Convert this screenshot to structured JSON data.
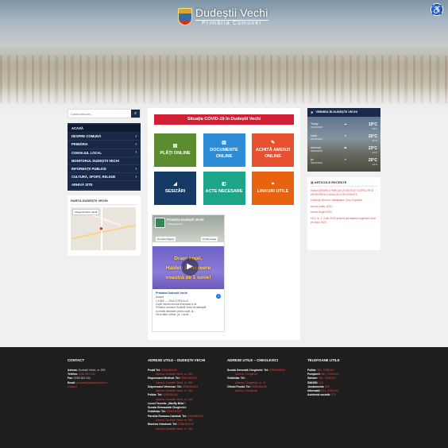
{
  "header": {
    "title": "Dudeștii Vechi",
    "subtitle": "Primăria Comunei"
  },
  "accessibility_icon": "accessibility-icon",
  "search": {
    "placeholder": "Caută articole..."
  },
  "menu": {
    "items": [
      {
        "label": "ACASĂ",
        "sub": false
      },
      {
        "label": "DESPRE COMUNĂ",
        "sub": true
      },
      {
        "label": "PRIMĂRIA",
        "sub": true
      },
      {
        "label": "CONSILIUL LOCAL",
        "sub": true
      },
      {
        "label": "MONITORUL DUDEȘTII VECHI",
        "sub": false
      },
      {
        "label": "INFORMAȚII PUBLICE",
        "sub": true
      },
      {
        "label": "CULTURĂ, SPORT, RELIGIE",
        "sub": true
      },
      {
        "label": "ARHIVĂ SITE",
        "sub": false
      }
    ]
  },
  "map_box": {
    "title": "HARTA DUDEȘTII VECHI",
    "button": "Afișează harta mărită"
  },
  "main": {
    "covid_banner": "Situația COVID-19 în Dudeștii Vechi",
    "tiles": [
      {
        "label1": "PLĂȚI ONLINE",
        "label2": "",
        "color": "#5b8d2f"
      },
      {
        "label1": "DOCUMENTE",
        "label2": "ONLINE",
        "color": "#2e8bd5"
      },
      {
        "label1": "ACHITĂ AMENZI",
        "label2": "ONLINE",
        "color": "#e8512f"
      },
      {
        "label1": "SESIZĂRI",
        "label2": "",
        "color": "#153a66"
      },
      {
        "label1": "ACTE NECESARE",
        "label2": "",
        "color": "#1da58a"
      },
      {
        "label1": "LINKURI UTILE",
        "label2": "",
        "color": "#e8620f"
      }
    ],
    "facebook": {
      "page_name": "Primăria Dudeștii Vechi",
      "likes": "2.002 aprecieri",
      "like_btn": "Îmi place Pagina",
      "send_btn": "Trimite mesaj",
      "poster_line1": "Dragi copii,",
      "poster_line2": "Haideți la recreere",
      "poster_line3": "voastră de 1 iunie!",
      "post_author": "Primăria Dudeștii Vechi",
      "post_time": "Aseară",
      "post_text1": "1 IUNIE — ZIUA COPILULUI",
      "post_text2": "Copiii merită cea mai frumoasă zi de",
      "post_text3": "Primăria comunei Dudeștii Vechi vă așteaptă",
      "post_text4": "cu multă distracție pentru copii, la...",
      "post_text5": "Vă invităm, mâine, joi, 1 iunie..."
    }
  },
  "weather": {
    "title": "VREMEA ÎN DUDEȘTII VECHI",
    "days": [
      {
        "day": "Today",
        "date": "01/06/2023",
        "temp": "19°C",
        "min": "10°C"
      },
      {
        "day": "marți",
        "date": "02/06/2023",
        "temp": "20°C",
        "min": "11°C"
      },
      {
        "day": "miercuri",
        "date": "03/06/2023",
        "temp": "23°C",
        "min": "13°C"
      },
      {
        "day": "joi",
        "date": "03/06/2023",
        "temp": "25°C",
        "min": "14°C"
      }
    ]
  },
  "articles": {
    "title": "ARTICOLE RECENTE",
    "items": [
      {
        "text": "INAUGURAREA PARCULUI DEDICAT COPIILOR ȘI INGRIJIREA CANALULUI DE IRIGAȚII",
        "date": ""
      },
      {
        "text": "Dudeștii Vechi în sărbătoare: Ziua Copilului",
        "date": ""
      },
      {
        "text": "Anunț public 2022",
        "date": ""
      },
      {
        "text": "Anunț Buget 2022",
        "date": ""
      },
      {
        "text": "HCL nr. 1, 3 din 2023 privind aprobarea bugetului local pe anul 2023",
        "date": ""
      }
    ]
  },
  "footer": {
    "contact": {
      "title": "CONTACT",
      "lines": [
        {
          "k": "Adresa:",
          "v": "Dudeștii Vechi, nr. 253"
        },
        {
          "k": "Telefon:",
          "v": "0256 384 104",
          "red": true
        },
        {
          "k": "Fax:",
          "v": "0256 384 104"
        },
        {
          "k": "Email:",
          "v": "primaria@dudestiivechi.ro",
          "red": true
        },
        {
          "k": "",
          "v": "Contact",
          "red": true
        }
      ]
    },
    "adrese_dv": {
      "title": "ADRESE UTILE – DUDEȘTII VECHI",
      "lines": [
        {
          "k": "Poștă Tel:",
          "v": "0256/384160"
        },
        {
          "k": "",
          "v": "Adresa: Dudeștii Vechi, nr. 253"
        },
        {
          "k": "Dispensarul Medical: Tel:",
          "v": "0256/384213"
        },
        {
          "k": "",
          "v": "Adresa: Dudeștii Vechi, nr. 253"
        },
        {
          "k": "Dispensarul Veterinar: Tel:",
          "v": "0256/384011"
        },
        {
          "k": "",
          "v": "Adresa: Dudeștii Vechi, nr. 253"
        },
        {
          "k": "Poliția: Tel:",
          "v": "0256/384111"
        },
        {
          "k": "",
          "v": "Adresa: Dudeștii Vechi, nr. 146"
        },
        {
          "k": "Liceul Teoretic „Bánffy Béla”:",
          "v": ""
        },
        {
          "k": "Școala Gimnazială Cheglevici:",
          "v": ""
        },
        {
          "k": "Grădinița: Tel:",
          "v": "0256/384027"
        },
        {
          "k": "Parohia Romano-Catolică: Tel:",
          "v": "0256/384124"
        },
        {
          "k": "",
          "v": "Adresa: Dudeștii Vechi, nr. 253"
        },
        {
          "k": "Biserica Ortodoxă: Tel:",
          "v": "0256/384040"
        },
        {
          "k": "",
          "v": "Adresa: Dudeștii Vechi, nr. 253"
        }
      ]
    },
    "adrese_ch": {
      "title": "ADRESE UTILE – CHEGLEVICI",
      "lines": [
        {
          "k": "Școala Generală Cheglevici: Tel:",
          "v": "0256/384094"
        },
        {
          "k": "",
          "v": "Adresa: Cheglevici"
        },
        {
          "k": "Grădinița: Tel:",
          "v": "–"
        },
        {
          "k": "",
          "v": "Adresa: Cheglevici, nr. 37"
        },
        {
          "k": "Oficiul Poștal: Tel:",
          "v": "0256/384030"
        },
        {
          "k": "",
          "v": "Adresa: Cheglevici"
        }
      ]
    },
    "telefoane": {
      "title": "TELEFOANE UTILE",
      "lines": [
        {
          "k": "Poliția:",
          "v": "981, 0256/112"
        },
        {
          "k": "Pompierii:",
          "v": "981, 0256/112"
        },
        {
          "k": "Salvare:",
          "v": "961, 0256/112"
        },
        {
          "k": "SMURD:",
          "v": "112"
        },
        {
          "k": "Jandarmeria:",
          "v": "956"
        },
        {
          "k": "Informații:",
          "v": "931, 0256/112"
        },
        {
          "k": "Asistență socială:",
          "v": "979"
        }
      ]
    }
  },
  "colors": {
    "navy": "#172849",
    "red": "#d11f33",
    "footer_bg": "#1e1e1e"
  }
}
